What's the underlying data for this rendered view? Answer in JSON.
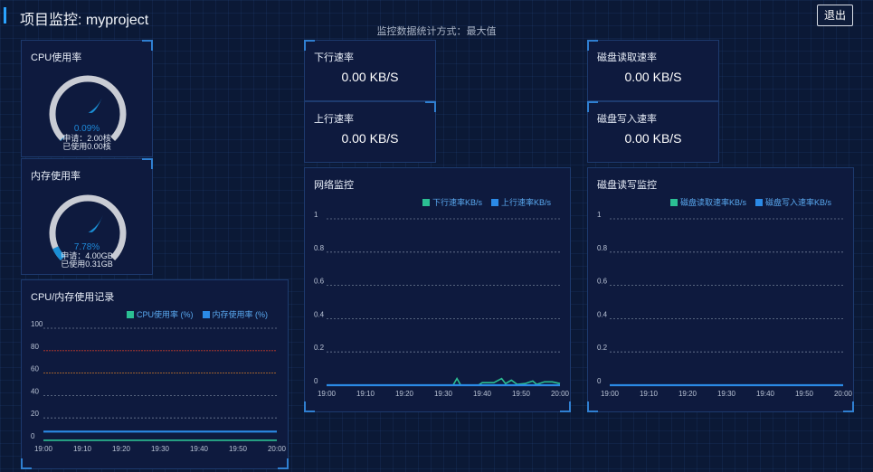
{
  "header": {
    "title": "项目监控: myproject",
    "logout_label": "退出",
    "stat_mode": "监控数据统计方式：最大值"
  },
  "cpu_gauge": {
    "title": "CPU使用率",
    "percent": 0.09,
    "percent_label": "0.09%",
    "request_label": "申请：2.00核",
    "used_label": "已使用0.00核"
  },
  "mem_gauge": {
    "title": "内存使用率",
    "percent": 7.78,
    "percent_label": "7.78%",
    "request_label": "申请：4.00GB",
    "used_label": "已使用0.31GB"
  },
  "metrics": {
    "down_title": "下行速率",
    "down_value": "0.00 KB/S",
    "up_title": "上行速率",
    "up_value": "0.00 KB/S",
    "disk_read_title": "磁盘读取速率",
    "disk_read_value": "0.00 KB/S",
    "disk_write_title": "磁盘写入速率",
    "disk_write_value": "0.00 KB/S"
  },
  "colors": {
    "green": "#2bbf93",
    "blue": "#2b8ae6",
    "red_line": "#c0392b",
    "orange_line": "#c8742a"
  },
  "chart_data": [
    {
      "type": "line",
      "title": "CPU/内存使用记录",
      "x": [
        "19:00",
        "19:10",
        "19:20",
        "19:30",
        "19:40",
        "19:50",
        "20:00"
      ],
      "ylim": [
        0,
        100
      ],
      "yticks": [
        "0",
        "20",
        "40",
        "60",
        "80",
        "100"
      ],
      "threshold_lines": [
        80,
        60
      ],
      "series": [
        {
          "name": "CPU使用率 (%)",
          "values": [
            0.1,
            0.1,
            0.1,
            0.1,
            0.1,
            0.1,
            0.1
          ]
        },
        {
          "name": "内存使用率 (%)",
          "values": [
            7.8,
            7.8,
            7.8,
            7.8,
            7.8,
            7.8,
            7.8
          ]
        }
      ]
    },
    {
      "type": "line",
      "title": "网络监控",
      "x": [
        "19:00",
        "19:10",
        "19:20",
        "19:30",
        "19:40",
        "19:50",
        "20:00"
      ],
      "ylim": [
        0,
        1
      ],
      "yticks": [
        "0",
        "0.2",
        "0.4",
        "0.6",
        "0.8",
        "1"
      ],
      "series": [
        {
          "name": "下行速率KB/s",
          "points": [
            [
              0,
              0
            ],
            [
              32.5,
              0
            ],
            [
              33.5,
              0.04
            ],
            [
              34.5,
              0
            ],
            [
              39,
              0
            ],
            [
              40,
              0.015
            ],
            [
              43,
              0.015
            ],
            [
              45,
              0.04
            ],
            [
              46,
              0.01
            ],
            [
              47.5,
              0.03
            ],
            [
              49,
              0.005
            ],
            [
              51,
              0.01
            ],
            [
              53,
              0.025
            ],
            [
              54,
              0.005
            ],
            [
              56,
              0.02
            ],
            [
              58,
              0.02
            ],
            [
              60,
              0.01
            ]
          ]
        },
        {
          "name": "上行速率KB/s",
          "points": [
            [
              0,
              0
            ],
            [
              60,
              0
            ]
          ]
        }
      ]
    },
    {
      "type": "line",
      "title": "磁盘读写监控",
      "x": [
        "19:00",
        "19:10",
        "19:20",
        "19:30",
        "19:40",
        "19:50",
        "20:00"
      ],
      "ylim": [
        0,
        1
      ],
      "yticks": [
        "0",
        "0.2",
        "0.4",
        "0.6",
        "0.8",
        "1"
      ],
      "series": [
        {
          "name": "磁盘读取速率KB/s",
          "points": [
            [
              0,
              0
            ],
            [
              60,
              0
            ]
          ]
        },
        {
          "name": "磁盘写入速率KB/s",
          "points": [
            [
              0,
              0
            ],
            [
              60,
              0
            ]
          ]
        }
      ]
    }
  ]
}
